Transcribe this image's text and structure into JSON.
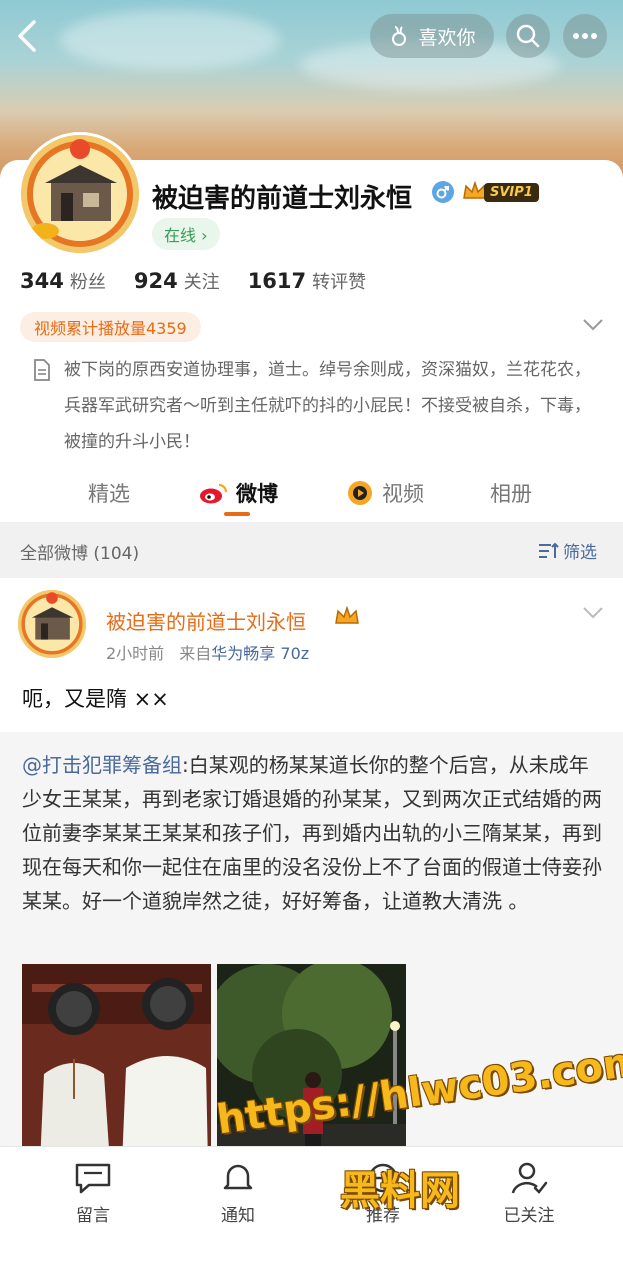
{
  "header": {
    "like_label": "喜欢你"
  },
  "profile": {
    "name": "被迫害的前道士刘永恒",
    "vip_label": "SVIP1",
    "online_label": "在线 ›",
    "stats": [
      {
        "value": "344",
        "label": "粉丝"
      },
      {
        "value": "924",
        "label": "关注"
      },
      {
        "value": "1617",
        "label": "转评赞"
      }
    ],
    "video_badge": "视频累计播放量4359",
    "bio": "被下岗的原西安道协理事，道士。绰号余则成，资深猫奴，兰花花农，兵器军武研究者～听到主任就吓的抖的小屁民！不接受被自杀，下毒，被撞的升斗小民！"
  },
  "tabs": [
    {
      "label": "精选"
    },
    {
      "label": "微博"
    },
    {
      "label": "视频"
    },
    {
      "label": "相册"
    }
  ],
  "section": {
    "title": "全部微博 (104)",
    "filter_label": "筛选"
  },
  "post": {
    "author": "被迫害的前道士刘永恒",
    "time": "2小时前",
    "from_prefix": "来自",
    "source": "华为畅享 70z",
    "text": "呃，又是隋 ××",
    "repost_mention": "@打击犯罪筹备组",
    "repost_text": ":白某观的杨某某道长你的整个后宫，从未成年少女王某某，再到老家订婚退婚的孙某某，又到两次正式结婚的两位前妻李某某王某某和孩子们，再到婚内出轨的小三隋某某，再到现在每天和你一起住在庙里的没名没份上不了台面的假道士侍妾孙某某。好一个道貌岸然之徒，好好筹备，让道教大清洗 。"
  },
  "bottom_nav": [
    {
      "label": "留言",
      "icon": "message-icon"
    },
    {
      "label": "通知",
      "icon": "bell-icon"
    },
    {
      "label": "推荐",
      "icon": "recommend-icon"
    },
    {
      "label": "已关注",
      "icon": "followed-icon"
    }
  ],
  "watermark": {
    "line1": "https://hlwc03.com",
    "line2": "黑料网"
  },
  "colors": {
    "orange": "#e86b16",
    "link_blue": "#4a6a9c",
    "green": "#3a9b57"
  }
}
